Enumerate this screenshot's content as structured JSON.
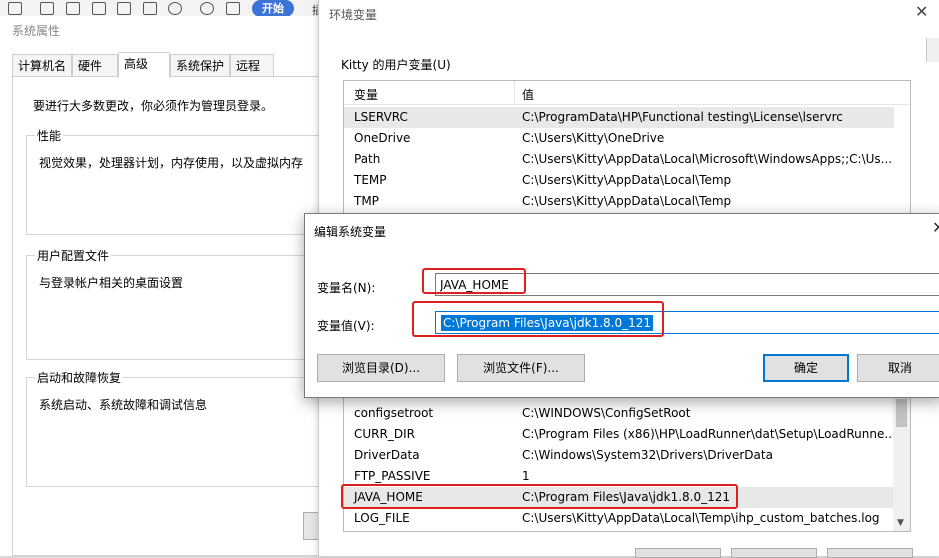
{
  "toolbar": {
    "start_label": "开始",
    "more_label": "插"
  },
  "sysprops": {
    "title": "系统属性",
    "tabs": [
      "计算机名",
      "硬件",
      "高级",
      "系统保护",
      "远程"
    ],
    "active_tab": "高级",
    "admin_note": "要进行大多数更改，你必须作为管理员登录。",
    "groups": [
      {
        "title": "性能",
        "desc": "视觉效果，处理器计划，内存使用，以及虚拟内存"
      },
      {
        "title": "用户配置文件",
        "desc": "与登录帐户相关的桌面设置"
      },
      {
        "title": "启动和故障恢复",
        "desc": "系统启动、系统故障和调试信息"
      }
    ]
  },
  "envwin": {
    "title": "环境变量",
    "user_group_label": "Kitty 的用户变量(U)",
    "col_name": "变量",
    "col_value": "值",
    "user_vars": [
      {
        "name": "LSERVRC",
        "value": "C:\\ProgramData\\HP\\Functional testing\\License\\lservrc"
      },
      {
        "name": "OneDrive",
        "value": "C:\\Users\\Kitty\\OneDrive"
      },
      {
        "name": "Path",
        "value": "C:\\Users\\Kitty\\AppData\\Local\\Microsoft\\WindowsApps;;C:\\Us..."
      },
      {
        "name": "TEMP",
        "value": "C:\\Users\\Kitty\\AppData\\Local\\Temp"
      },
      {
        "name": "TMP",
        "value": "C:\\Users\\Kitty\\AppData\\Local\\Temp"
      }
    ],
    "system_vars": [
      {
        "name": "configsetroot",
        "value": "C:\\WINDOWS\\ConfigSetRoot"
      },
      {
        "name": "CURR_DIR",
        "value": "C:\\Program Files (x86)\\HP\\LoadRunner\\dat\\Setup\\LoadRunne..."
      },
      {
        "name": "DriverData",
        "value": "C:\\Windows\\System32\\Drivers\\DriverData"
      },
      {
        "name": "FTP_PASSIVE",
        "value": "1"
      },
      {
        "name": "JAVA_HOME",
        "value": "C:\\Program Files\\Java\\jdk1.8.0_121"
      },
      {
        "name": "LOG_FILE",
        "value": "C:\\Users\\Kitty\\AppData\\Local\\Temp\\ihp_custom_batches.log"
      }
    ]
  },
  "edit_dialog": {
    "title": "编辑系统变量",
    "name_label": "变量名(N):",
    "value_label": "变量值(V):",
    "name_value": "JAVA_HOME",
    "value_value": "C:\\Program Files\\Java\\jdk1.8.0_121",
    "browse_dir_label": "浏览目录(D)...",
    "browse_file_label": "浏览文件(F)...",
    "ok_label": "确定",
    "cancel_label": "取消"
  },
  "colors": {
    "highlight": "#e02020",
    "selection": "#0078d7",
    "start_button": "#3b73d6"
  }
}
